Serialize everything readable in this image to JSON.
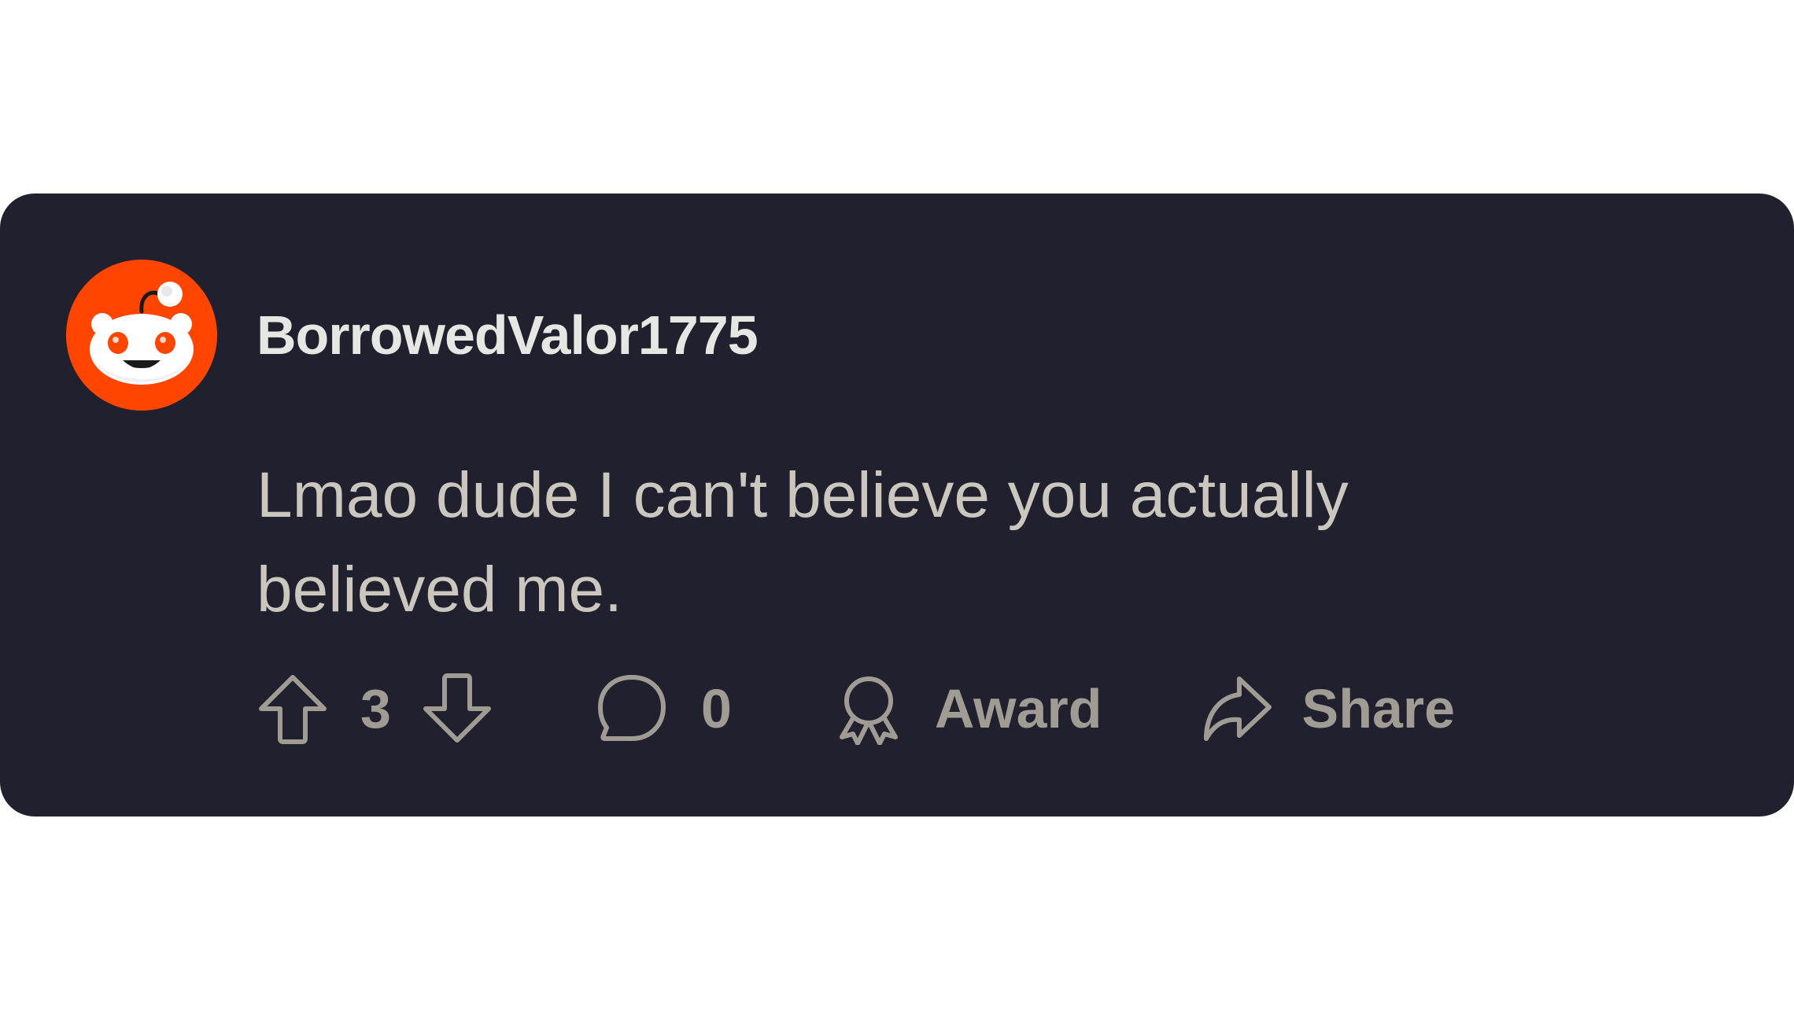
{
  "comment": {
    "username": "BorrowedValor1775",
    "body": "Lmao dude I can't believe you actually believed me.",
    "avatar_icon": "reddit-snoo-avatar",
    "colors": {
      "card_background": "#20202f",
      "avatar_orange": "#ff4500",
      "username": "#e6e6e2",
      "body_text": "#cbc6be",
      "action_text": "#a09b93"
    }
  },
  "actions": {
    "upvote_icon": "arrow-up-icon",
    "vote_count": "3",
    "downvote_icon": "arrow-down-icon",
    "comment_icon": "speech-bubble-icon",
    "comment_count": "0",
    "award_icon": "award-ribbon-icon",
    "award_label": "Award",
    "share_icon": "share-arrow-icon",
    "share_label": "Share"
  }
}
